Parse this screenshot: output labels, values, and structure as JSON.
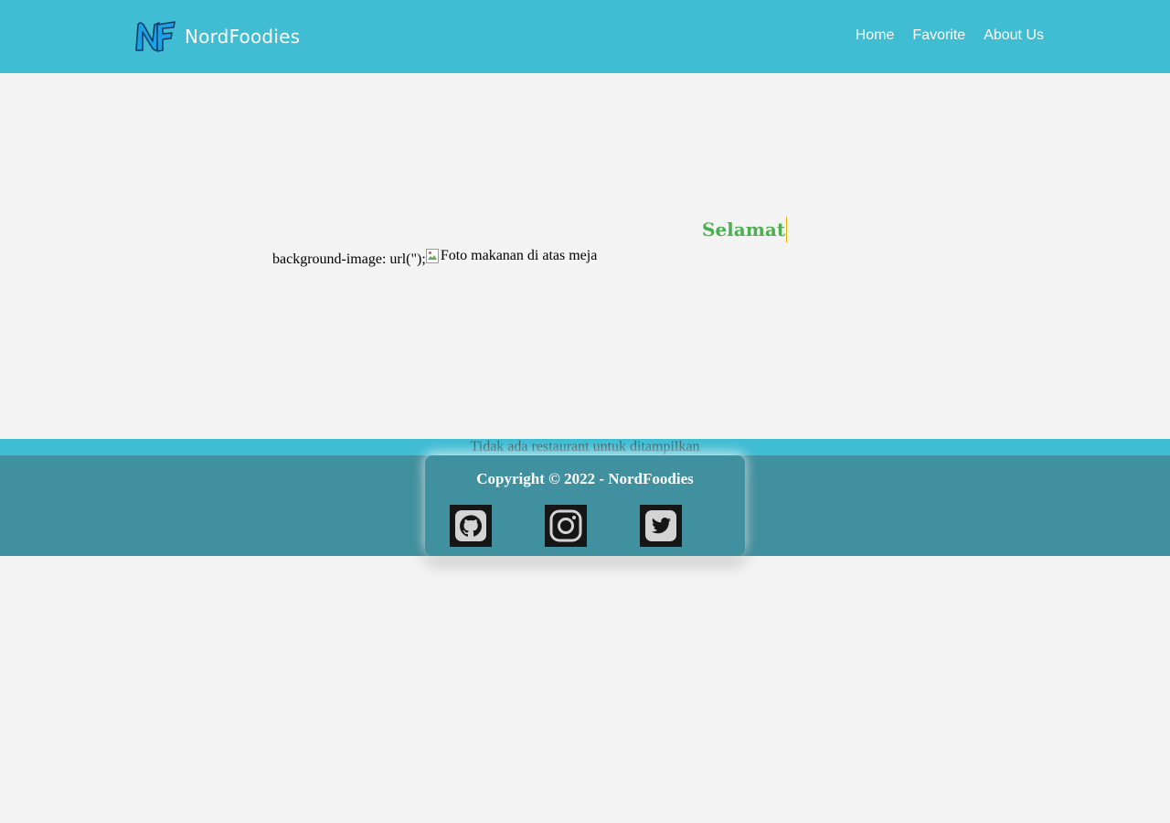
{
  "brand": {
    "logo_icon": "nf-logo-icon",
    "name": "NordFoodies",
    "colors": {
      "header": "#40bcd3",
      "footer": "#40909f",
      "accent_green": "#4caf50",
      "page": "#f4f4f4"
    }
  },
  "nav": {
    "items": [
      {
        "label": "Home"
      },
      {
        "label": "Favorite"
      },
      {
        "label": "About Us"
      }
    ]
  },
  "hero": {
    "heading": "Selamat",
    "css_text": "background-image: url(\");",
    "image_alt": "Foto makanan di atas meja",
    "broken_image_icon": "broken-image-icon"
  },
  "restaurants": {
    "empty_message": "Tidak ada restaurant untuk ditampilkan"
  },
  "footer": {
    "copyright": "Copyright © 2022 - NordFoodies",
    "social": [
      {
        "icon": "github-icon"
      },
      {
        "icon": "instagram-icon"
      },
      {
        "icon": "twitter-icon"
      }
    ]
  }
}
